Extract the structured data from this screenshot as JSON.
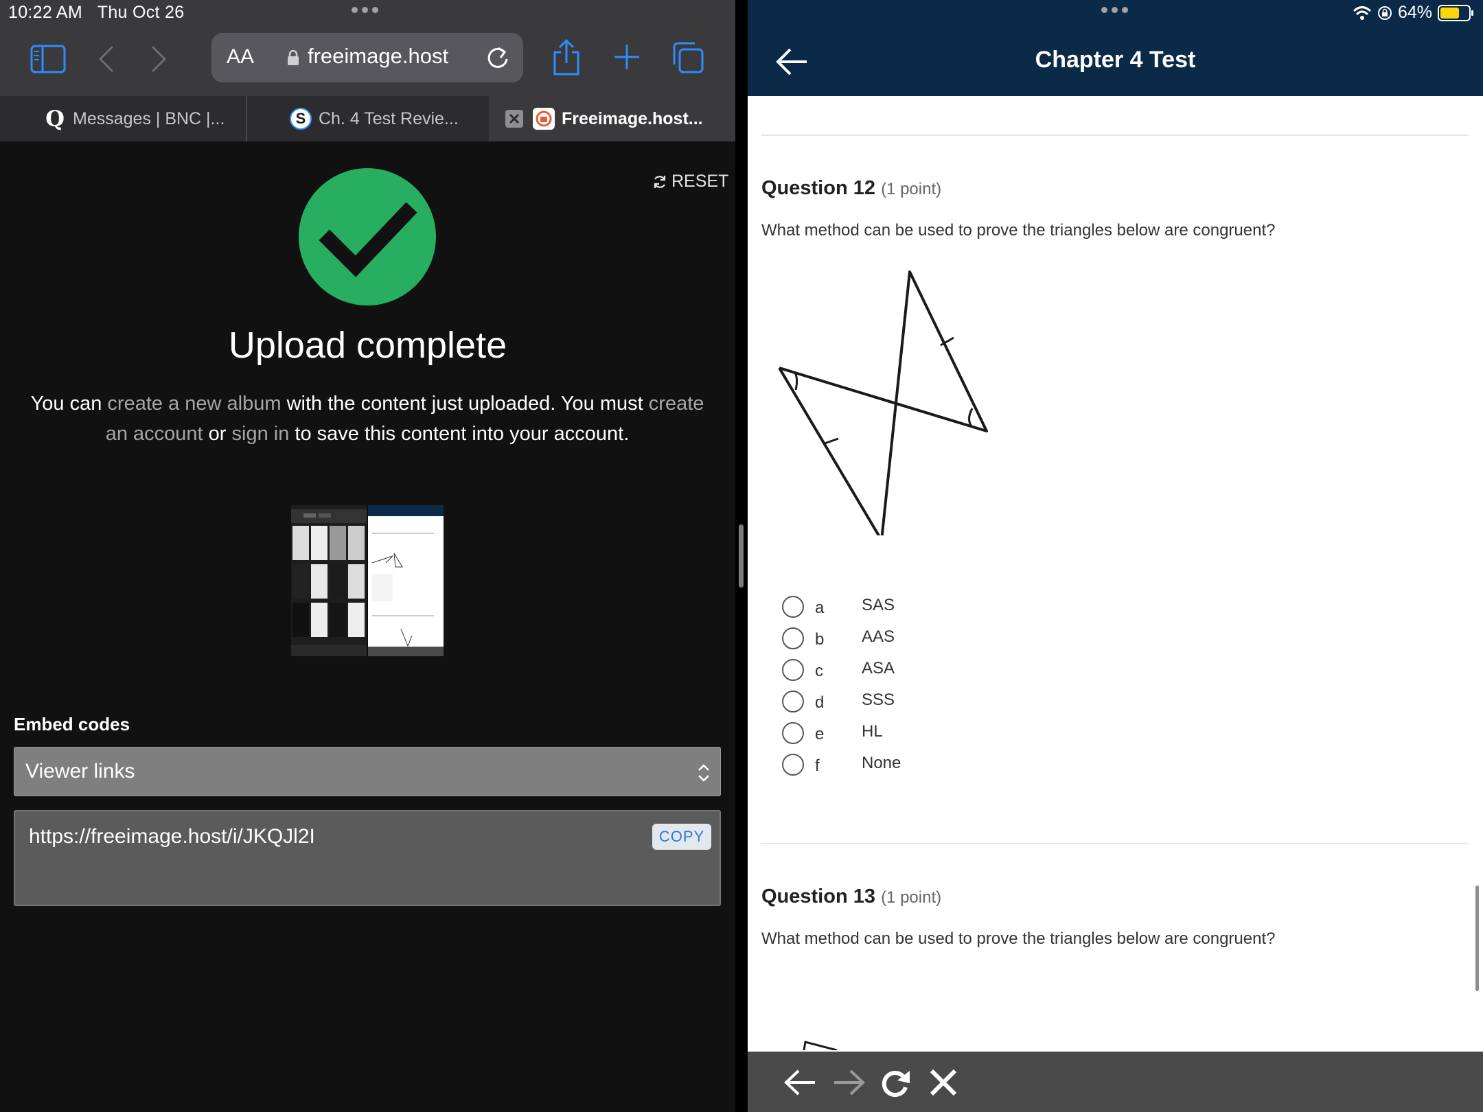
{
  "status": {
    "time": "10:22 AM",
    "date": "Thu Oct 26",
    "battery": "64%"
  },
  "left": {
    "address": {
      "aa": "AA",
      "url": "freeimage.host"
    },
    "tabs": [
      {
        "label": "Messages | BNC |...",
        "favicon": "Q"
      },
      {
        "label": "Ch. 4 Test Revie...",
        "favicon": "S"
      },
      {
        "label": "Freeimage.host...",
        "favicon": "freeimage-logo"
      }
    ],
    "reset_label": "RESET",
    "title": "Upload complete",
    "desc": {
      "p1": "You can ",
      "link1": "create a new album",
      "p2": " with the content just uploaded. You must ",
      "link2": "create an account",
      "p3": " or ",
      "link3": "sign in",
      "p4": " to save this content into your account."
    },
    "embed": {
      "label": "Embed codes",
      "select_value": "Viewer links",
      "url": "https://freeimage.host/i/JKQJl2I",
      "copy_label": "COPY"
    }
  },
  "right": {
    "header_title": "Chapter 4 Test",
    "q12": {
      "number": "Question 12",
      "points": "(1 point)",
      "text": "What method can be used to prove the triangles below are congruent?",
      "options": [
        {
          "letter": "a",
          "text": "SAS"
        },
        {
          "letter": "b",
          "text": "AAS"
        },
        {
          "letter": "c",
          "text": "ASA"
        },
        {
          "letter": "d",
          "text": "SSS"
        },
        {
          "letter": "e",
          "text": "HL"
        },
        {
          "letter": "f",
          "text": "None"
        }
      ]
    },
    "q13": {
      "number": "Question 13",
      "points": "(1 point)",
      "text": "What method can be used to prove the triangles below are congruent?"
    }
  },
  "colors": {
    "header_navy": "#0a2a47",
    "success_green": "#27ae60",
    "link_blue": "#2b7cd3",
    "battery_yellow": "#ffd60a"
  }
}
